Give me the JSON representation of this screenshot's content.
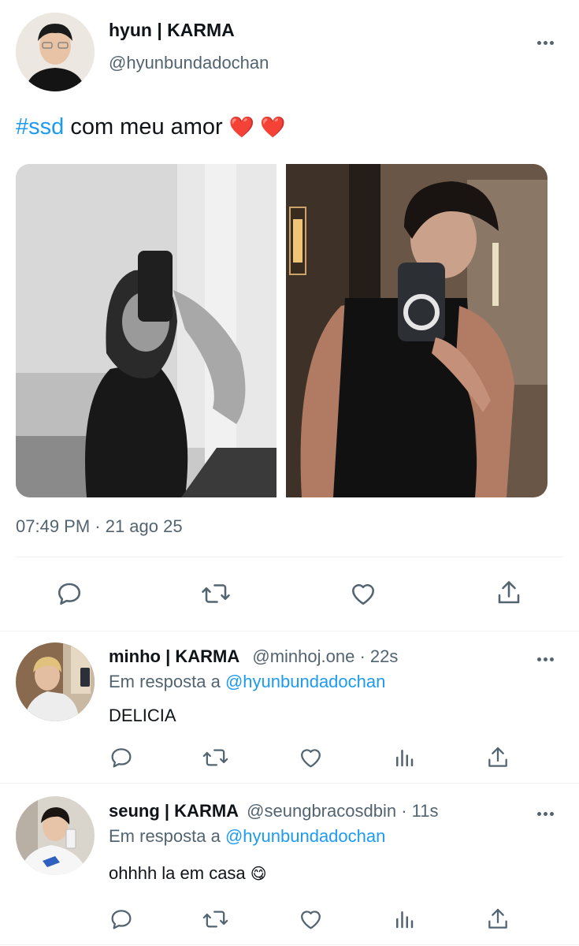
{
  "post": {
    "author_name": "hyun | KARMA",
    "author_handle": "@hyunbundadochan",
    "hashtag": "#ssd",
    "text": " com meu amor",
    "emoji": "❤️ ❤️",
    "timestamp": "07:49 PM · 21 ago 25"
  },
  "replies": [
    {
      "name": "minho | KARMA",
      "handle": "@minhoj.one",
      "time": "· 22s",
      "reply_prefix": "Em resposta a",
      "reply_to": "@hyunbundadochan",
      "text": "DELICIA"
    },
    {
      "name": "seung | KARMA",
      "handle": "@seungbracosdbin",
      "time": "· 11s",
      "reply_prefix": "Em resposta a",
      "reply_to": "@hyunbundadochan",
      "text": "ohhhh la em casa",
      "emoji": "😋"
    }
  ],
  "colors": {
    "link": "#1d9bf0",
    "secondary_text": "#536471",
    "divider": "#eff3f4",
    "primary_text": "#0f1419"
  },
  "icons": [
    "more-icon",
    "reply-icon",
    "retweet-icon",
    "like-icon",
    "views-icon",
    "share-icon"
  ]
}
